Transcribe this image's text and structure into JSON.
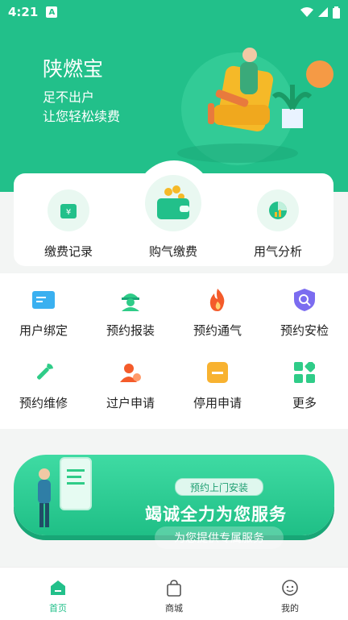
{
  "status": {
    "time": "4:21",
    "badge": "A"
  },
  "hero": {
    "title": "陕燃宝",
    "line1": "足不出户",
    "line2": "让您轻松续费"
  },
  "top_actions": [
    {
      "label": "缴费记录",
      "icon": "receipt-icon"
    },
    {
      "label": "购气缴费",
      "icon": "wallet-icon"
    },
    {
      "label": "用气分析",
      "icon": "pie-chart-icon"
    }
  ],
  "services": [
    {
      "label": "用户绑定",
      "icon": "id-card-icon"
    },
    {
      "label": "预约报装",
      "icon": "worker-icon"
    },
    {
      "label": "预约通气",
      "icon": "flame-icon"
    },
    {
      "label": "预约安检",
      "icon": "shield-search-icon"
    },
    {
      "label": "预约维修",
      "icon": "wrench-icon"
    },
    {
      "label": "过户申请",
      "icon": "transfer-user-icon"
    },
    {
      "label": "停用申请",
      "icon": "stop-icon"
    },
    {
      "label": "更多",
      "icon": "more-grid-icon"
    }
  ],
  "banner": {
    "tag": "预约上门安装",
    "main": "竭诚全力为您服务",
    "sub": "为您提供专属服务"
  },
  "nav": [
    {
      "label": "首页",
      "icon": "home-icon"
    },
    {
      "label": "商城",
      "icon": "shopping-bag-icon"
    },
    {
      "label": "我的",
      "icon": "profile-icon"
    }
  ],
  "colors": {
    "brand": "#22c08a",
    "accent_orange": "#f57c3a",
    "purple": "#6c5ce7"
  }
}
